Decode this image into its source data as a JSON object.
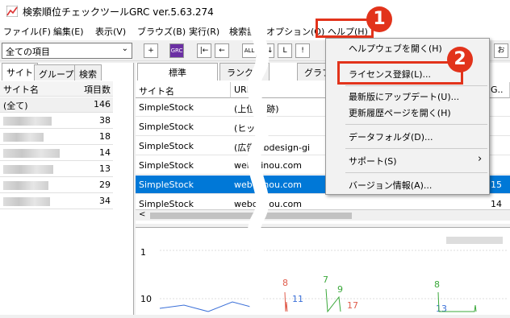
{
  "window": {
    "title": "検索順位チェックツールGRC  ver.5.63.274"
  },
  "menubar": {
    "items": [
      "ファイル(F)",
      "編集(E)",
      "表示(V)",
      "ブラウズ(B)",
      "実行(R)",
      "検索設",
      "オプション(O)",
      "ヘルプ(H)"
    ]
  },
  "toolbar": {
    "combo_value": "全ての項目",
    "btn_grc": "GRC",
    "btn_all": "ALL",
    "btn_o": "お"
  },
  "left_panel": {
    "tabs": [
      "サイト",
      "グループ",
      "検索"
    ],
    "headers": {
      "name": "サイト名",
      "count": "項目数"
    },
    "rows": [
      {
        "name": "(全て)",
        "count": "146"
      },
      {
        "name": "",
        "count": "38"
      },
      {
        "name": "",
        "count": "18"
      },
      {
        "name": "",
        "count": "14"
      },
      {
        "name": "",
        "count": "13"
      },
      {
        "name": "",
        "count": "29"
      },
      {
        "name": "",
        "count": "34"
      }
    ]
  },
  "main_panel": {
    "tabs": [
      "標準",
      "ランクイ",
      "グラフ"
    ],
    "headers": {
      "site": "サイト名",
      "url": "URL",
      "g": "G.."
    },
    "rows": [
      {
        "site": "SimpleStock",
        "url": "(上位... 跡)",
        "g": ""
      },
      {
        "site": "SimpleStock",
        "url": "(ヒット",
        "g": ""
      },
      {
        "site": "SimpleStock",
        "url": "(広告 ebdesign-gi",
        "g": ""
      },
      {
        "site": "SimpleStock",
        "url": "web ginou.com",
        "g": ""
      },
      {
        "site": "SimpleStock",
        "url": "webd inou.com",
        "g": "15"
      },
      {
        "site": "SimpleStock",
        "url": "webd inou.com",
        "g": "14"
      }
    ]
  },
  "chart_data": {
    "type": "line",
    "y_ticks": [
      "1",
      "10"
    ],
    "labels": [
      "8",
      "7",
      "9",
      "11",
      "17",
      "8",
      "13"
    ],
    "colors": {
      "red": "#e05c4b",
      "green": "#3aa83a",
      "blue": "#3a6fd8"
    }
  },
  "help_menu": {
    "items": [
      "ヘルプウェブを開く(H)",
      "ライセンス登録(L)...",
      "最新版にアップデート(U)...",
      "更新履歴ページを開く(H)",
      "データフォルダ(D)...",
      "サポート(S)",
      "バージョン情報(A)..."
    ],
    "submenu_arrow": "›"
  },
  "callouts": {
    "badge1": "1",
    "badge2": "2"
  },
  "colors": {
    "accent_red": "#e2331b",
    "selection": "#0078d7"
  }
}
